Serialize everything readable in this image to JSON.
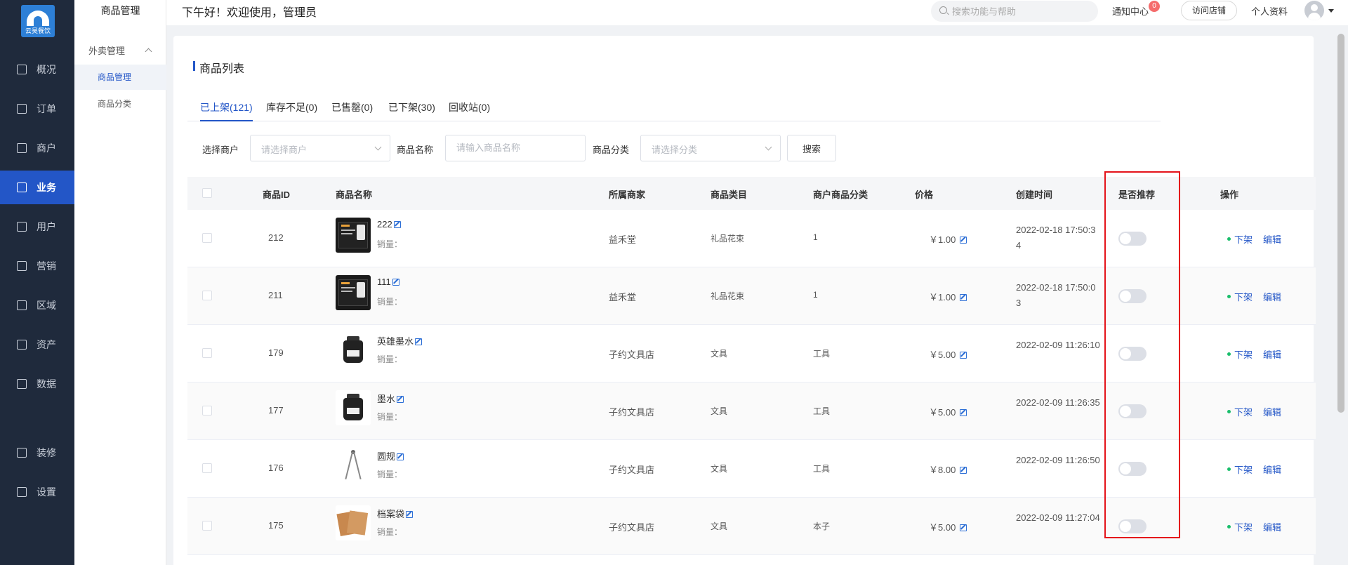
{
  "logo": {
    "text": "云昊餐饮"
  },
  "rail": [
    {
      "label": "概况",
      "icon": "overview-icon"
    },
    {
      "label": "订单",
      "icon": "order-icon"
    },
    {
      "label": "商户",
      "icon": "merchant-icon"
    },
    {
      "label": "业务",
      "icon": "business-icon",
      "active": true
    },
    {
      "label": "用户",
      "icon": "user-icon"
    },
    {
      "label": "营销",
      "icon": "marketing-icon"
    },
    {
      "label": "区域",
      "icon": "region-icon"
    },
    {
      "label": "资产",
      "icon": "asset-icon"
    },
    {
      "label": "数据",
      "icon": "data-icon"
    },
    {
      "label": "装修",
      "icon": "decorate-icon"
    },
    {
      "label": "设置",
      "icon": "settings-icon"
    }
  ],
  "subnav": {
    "title": "商品管理",
    "group": "外卖管理",
    "items": [
      {
        "label": "商品管理",
        "active": true
      },
      {
        "label": "商品分类"
      }
    ]
  },
  "header": {
    "welcome": "下午好！欢迎使用，管理员",
    "search_placeholder": "搜索功能与帮助",
    "notify_label": "通知中心",
    "notify_count": "0",
    "visit_label": "访问店铺",
    "profile_label": "个人资料"
  },
  "page": {
    "title": "商品列表",
    "tabs": [
      "已上架(121)",
      "库存不足(0)",
      "已售罄(0)",
      "已下架(30)",
      "回收站(0)"
    ],
    "filters": {
      "merchant_label": "选择商户",
      "merchant_placeholder": "请选择商户",
      "name_label": "商品名称",
      "name_placeholder": "请输入商品名称",
      "category_label": "商品分类",
      "category_placeholder": "请选择分类",
      "search_button": "搜索"
    }
  },
  "table": {
    "headers": [
      "商品ID",
      "商品名称",
      "所属商家",
      "商品类目",
      "商户商品分类",
      "价格",
      "创建时间",
      "是否推荐",
      "操作"
    ],
    "sales_label": "销量：",
    "off_label": "下架",
    "edit_label": "编辑",
    "rows": [
      {
        "id": "212",
        "name": "222",
        "thumb": "phone",
        "merchant": "益禾堂",
        "category": "礼品花束",
        "merchant_category": "1",
        "price": "￥1.00",
        "created": "2022-02-18 17:50:34"
      },
      {
        "id": "211",
        "name": "111",
        "thumb": "phone",
        "merchant": "益禾堂",
        "category": "礼品花束",
        "merchant_category": "1",
        "price": "￥1.00",
        "created": "2022-02-18 17:50:03"
      },
      {
        "id": "179",
        "name": "英雄墨水",
        "thumb": "ink",
        "merchant": "子约文具店",
        "category": "文具",
        "merchant_category": "工具",
        "price": "￥5.00",
        "created": "2022-02-09 11:26:10"
      },
      {
        "id": "177",
        "name": "墨水",
        "thumb": "ink",
        "merchant": "子约文具店",
        "category": "文具",
        "merchant_category": "工具",
        "price": "￥5.00",
        "created": "2022-02-09 11:26:35"
      },
      {
        "id": "176",
        "name": "圆规",
        "thumb": "compass",
        "merchant": "子约文具店",
        "category": "文具",
        "merchant_category": "工具",
        "price": "￥8.00",
        "created": "2022-02-09 11:26:50"
      },
      {
        "id": "175",
        "name": "档案袋",
        "thumb": "envelope",
        "merchant": "子约文具店",
        "category": "文具",
        "merchant_category": "本子",
        "price": "￥5.00",
        "created": "2022-02-09 11:27:04"
      }
    ]
  },
  "colors": {
    "accent": "#2356c7",
    "sidebar": "#1f2a3c",
    "highlight": "#e4141b",
    "online": "#19be6b"
  }
}
